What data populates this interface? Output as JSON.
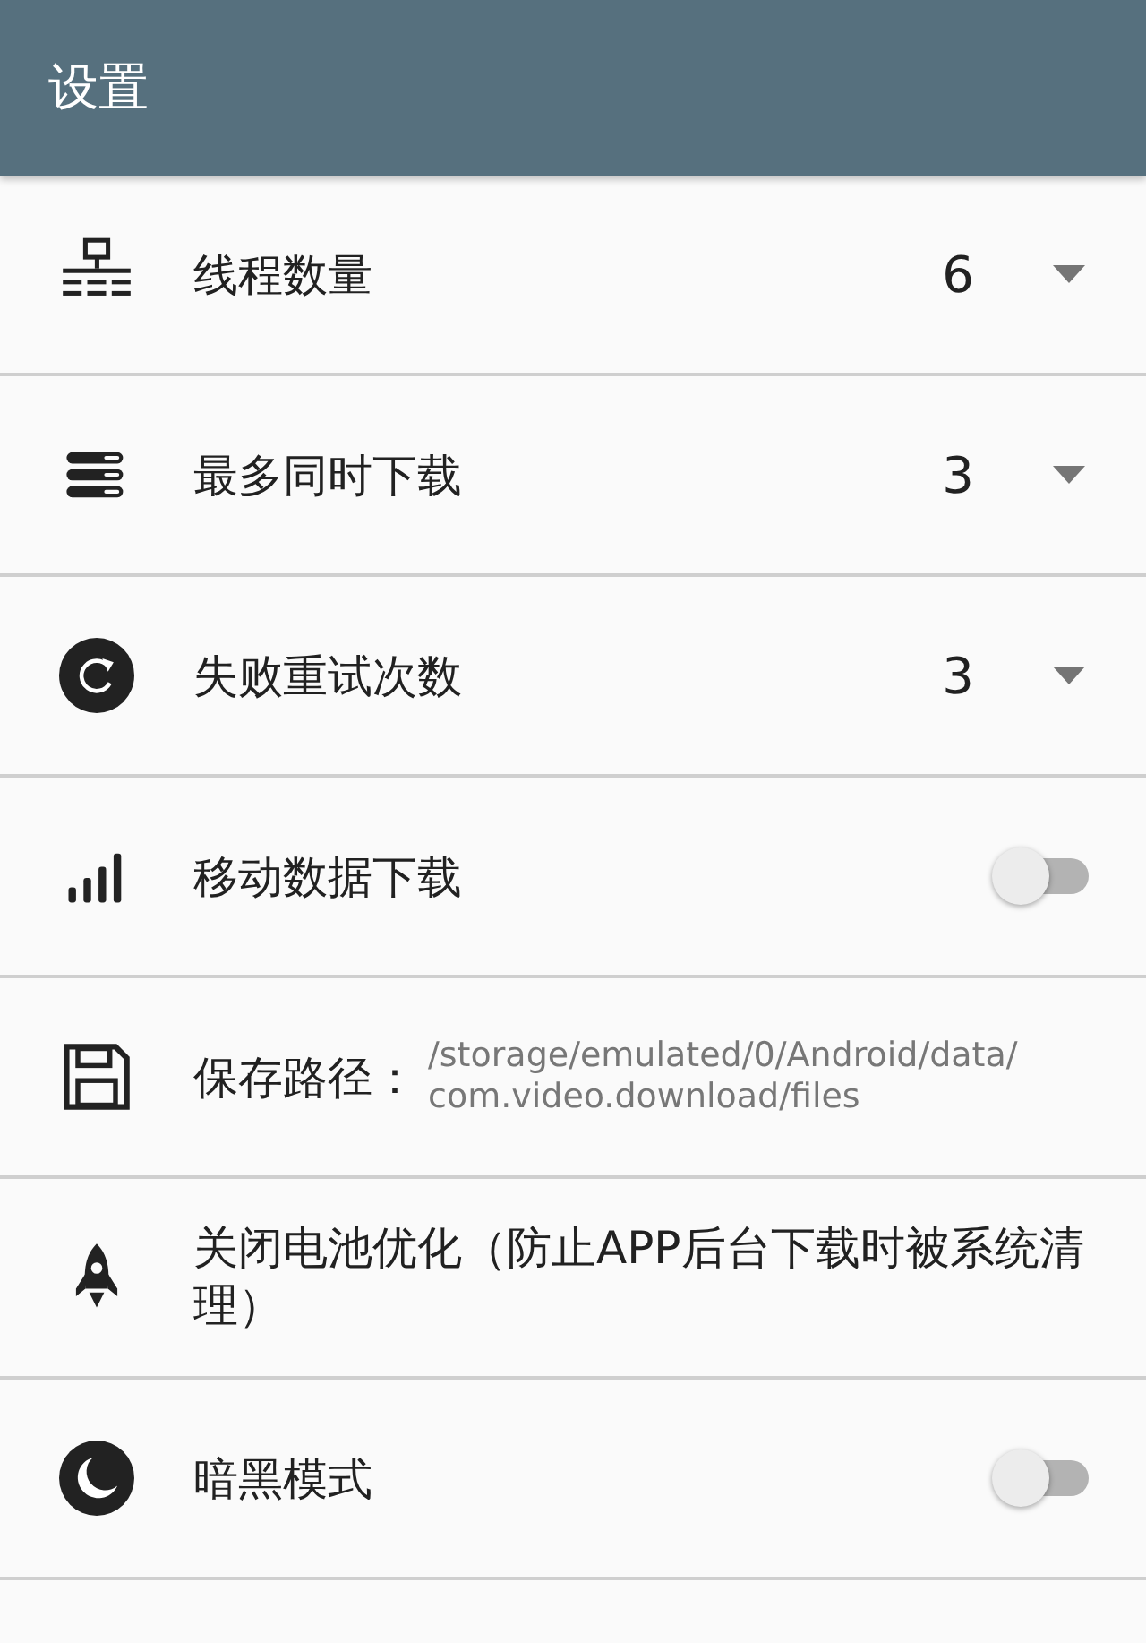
{
  "app_bar": {
    "title": "设置"
  },
  "settings": [
    {
      "kind": "dropdown",
      "label": "线程数量",
      "value": "6"
    },
    {
      "kind": "dropdown",
      "label": "最多同时下载",
      "value": "3"
    },
    {
      "kind": "dropdown",
      "label": "失败重试次数",
      "value": "3"
    },
    {
      "kind": "toggle",
      "label": "移动数据下载",
      "on": false
    },
    {
      "kind": "path",
      "label": "保存路径：",
      "value_lines": [
        "/storage/emulated/0/Android/data/",
        "com.video.download/files"
      ]
    },
    {
      "kind": "text",
      "label": "关闭电池优化（防止APP后台下载时被系统清理）"
    },
    {
      "kind": "toggle",
      "label": "暗黑模式",
      "on": false
    }
  ]
}
